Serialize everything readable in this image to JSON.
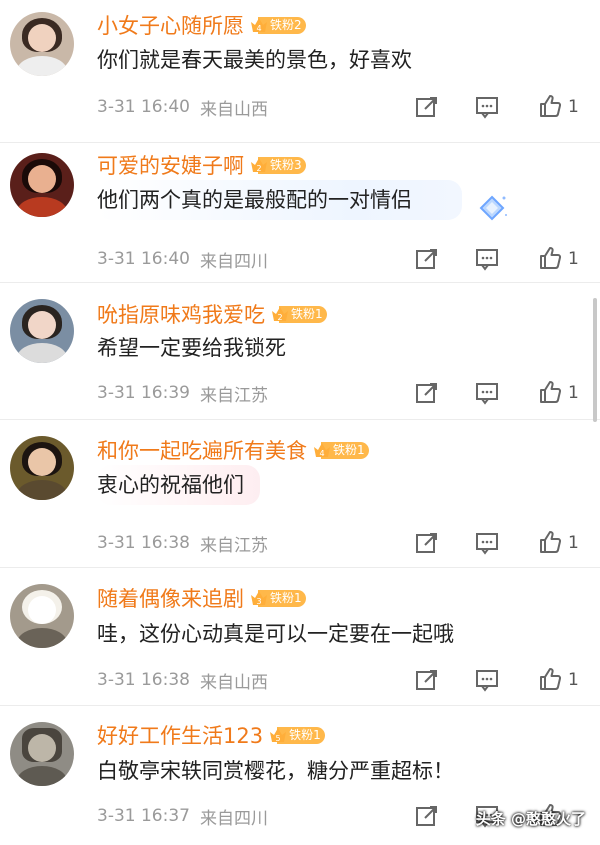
{
  "comments": [
    {
      "username": "小女子心随所愿",
      "fan_level": "4",
      "fan_label": "铁粉2",
      "text": "你们就是春天最美的景色，好喜欢",
      "time": "3-31 16:40",
      "location": "来自山西",
      "likes": "1",
      "avatar_color": "#c9b8a8"
    },
    {
      "username": "可爱的安婕子啊",
      "fan_level": "2",
      "fan_label": "铁粉3",
      "text": "他们两个真的是最般配的一对情侣",
      "time": "3-31 16:40",
      "location": "来自四川",
      "likes": "1",
      "avatar_color": "#5a1f1a"
    },
    {
      "username": "吮指原味鸡我爱吃",
      "fan_level": "2",
      "fan_label": "铁粉1",
      "text": "希望一定要给我锁死",
      "time": "3-31 16:39",
      "location": "来自江苏",
      "likes": "1",
      "avatar_color": "#7b8ea3"
    },
    {
      "username": "和你一起吃遍所有美食",
      "fan_level": "4",
      "fan_label": "铁粉1",
      "text": "衷心的祝福他们",
      "time": "3-31 16:38",
      "location": "来自江苏",
      "likes": "1",
      "avatar_color": "#6b5a2c"
    },
    {
      "username": "随着偶像来追剧",
      "fan_level": "3",
      "fan_label": "铁粉1",
      "text": "哇，这份心动真是可以一定要在一起哦",
      "time": "3-31 16:38",
      "location": "来自山西",
      "likes": "1",
      "avatar_color": "#a39a8c"
    },
    {
      "username": "好好工作生活123",
      "fan_level": "5",
      "fan_label": "铁粉1",
      "text": "白敬亭宋轶同赏樱花，糖分严重超标！",
      "time": "3-31 16:37",
      "location": "来自四川",
      "likes": "",
      "avatar_color": "#8f8c85"
    }
  ],
  "watermark": "头条 @憨憨火了",
  "colors": {
    "username": "#f07a1a",
    "badge": "#ffb84a",
    "meta": "#9a9a9a"
  },
  "icons": {
    "share": "share-icon",
    "reply": "comment-icon",
    "like": "thumbs-up-icon"
  }
}
